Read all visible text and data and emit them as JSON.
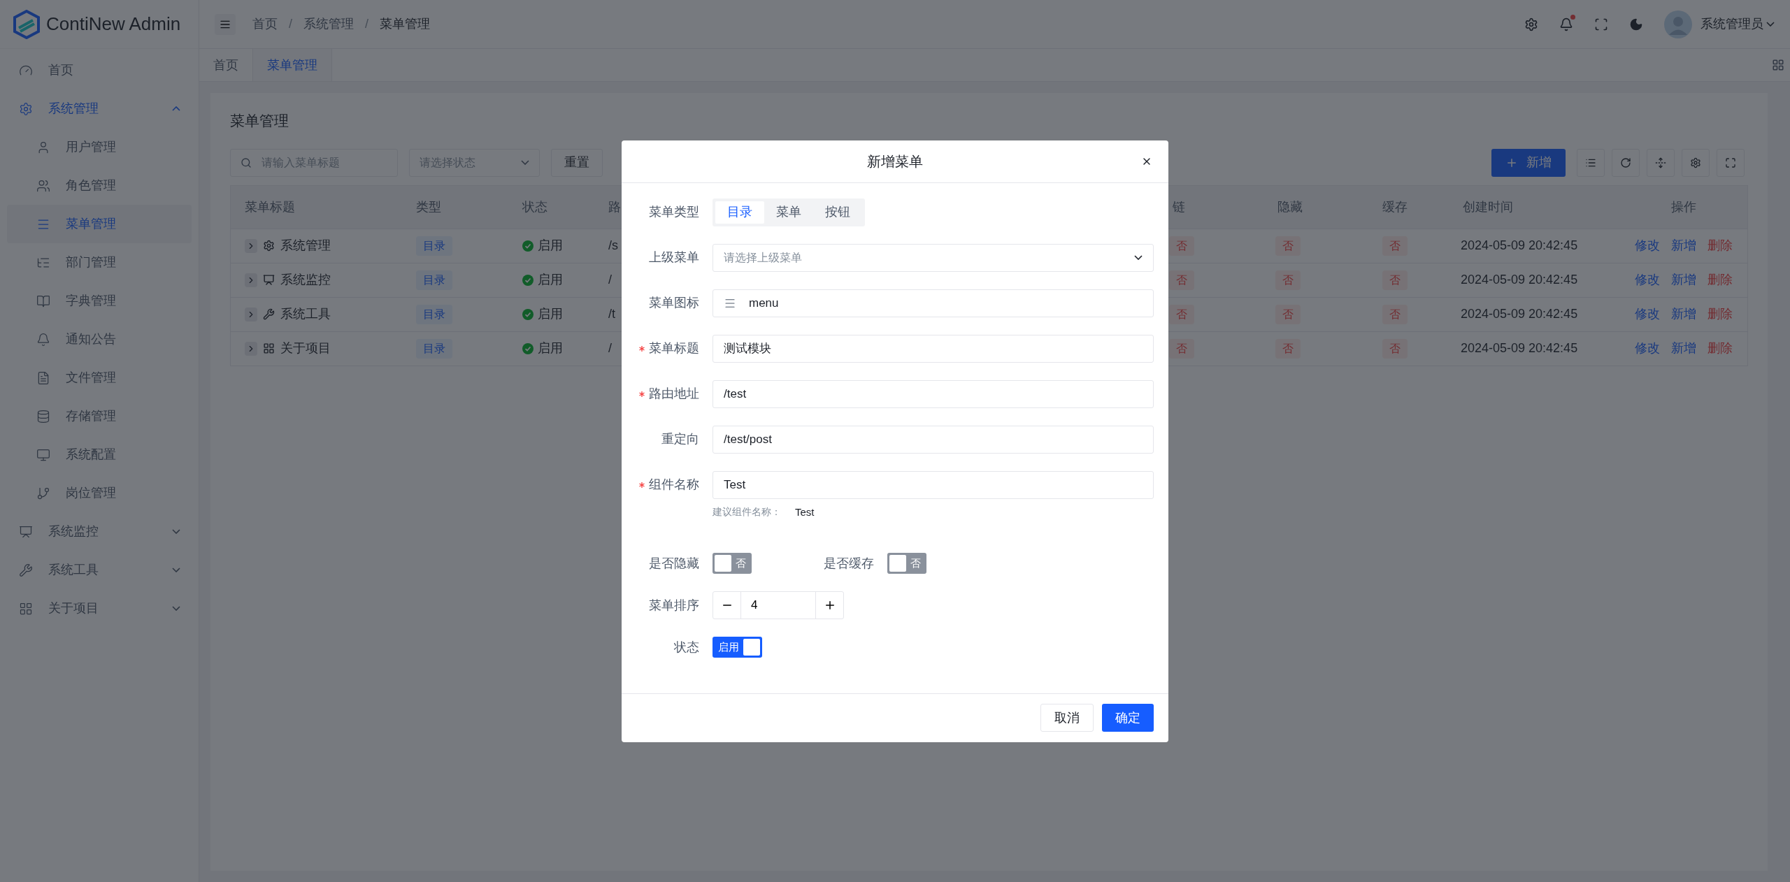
{
  "header": {
    "logo_text": "ContiNew Admin",
    "breadcrumb": [
      "首页",
      "系统管理",
      "菜单管理"
    ],
    "separators": [
      "/",
      "/"
    ],
    "has_unread": true,
    "user_name": "系统管理员"
  },
  "sidebar": {
    "items": [
      {
        "label": "首页",
        "selected": false
      },
      {
        "label": "系统管理",
        "selected": true,
        "expanded": true,
        "children": [
          {
            "label": "用户管理",
            "selected": false
          },
          {
            "label": "角色管理",
            "selected": false
          },
          {
            "label": "菜单管理",
            "selected": true
          },
          {
            "label": "部门管理",
            "selected": false
          },
          {
            "label": "字典管理",
            "selected": false
          },
          {
            "label": "通知公告",
            "selected": false
          },
          {
            "label": "文件管理",
            "selected": false
          },
          {
            "label": "存储管理",
            "selected": false
          },
          {
            "label": "系统配置",
            "selected": false
          },
          {
            "label": "岗位管理",
            "selected": false
          }
        ]
      },
      {
        "label": "系统监控",
        "selected": false,
        "expanded": false
      },
      {
        "label": "系统工具",
        "selected": false,
        "expanded": false
      },
      {
        "label": "关于项目",
        "selected": false,
        "expanded": false
      }
    ]
  },
  "tabs": [
    {
      "label": "首页",
      "selected": false
    },
    {
      "label": "菜单管理",
      "selected": true
    }
  ],
  "page_title": "菜单管理",
  "toolbar": {
    "search_placeholder": "请输入菜单标题",
    "status_placeholder": "请选择状态",
    "reset_label": "重置",
    "add_label": "新增"
  },
  "table": {
    "columns": [
      "菜单标题",
      "类型",
      "状态",
      "路",
      "链",
      "隐藏",
      "缓存",
      "创建时间",
      "操作"
    ],
    "rows": [
      {
        "title": "系统管理",
        "type": "目录",
        "status": "启用",
        "path": "/s",
        "external": "否",
        "hidden": "否",
        "cache": "否",
        "created": "2024-05-09 20:42:45",
        "actions": [
          {
            "label": "修改",
            "kind": "link"
          },
          {
            "label": "新增",
            "kind": "link"
          },
          {
            "label": "删除",
            "kind": "danger"
          }
        ]
      },
      {
        "title": "系统监控",
        "type": "目录",
        "status": "启用",
        "path": "/",
        "external": "否",
        "hidden": "否",
        "cache": "否",
        "created": "2024-05-09 20:42:45",
        "actions": [
          {
            "label": "修改",
            "kind": "link"
          },
          {
            "label": "新增",
            "kind": "link"
          },
          {
            "label": "删除",
            "kind": "danger"
          }
        ]
      },
      {
        "title": "系统工具",
        "type": "目录",
        "status": "启用",
        "path": "/t",
        "external": "否",
        "hidden": "否",
        "cache": "否",
        "created": "2024-05-09 20:42:45",
        "actions": [
          {
            "label": "修改",
            "kind": "link"
          },
          {
            "label": "新增",
            "kind": "link"
          },
          {
            "label": "删除",
            "kind": "danger"
          }
        ]
      },
      {
        "title": "关于项目",
        "type": "目录",
        "status": "启用",
        "path": "/",
        "external": "否",
        "hidden": "否",
        "cache": "否",
        "created": "2024-05-09 20:42:45",
        "actions": [
          {
            "label": "修改",
            "kind": "link"
          },
          {
            "label": "新增",
            "kind": "link"
          },
          {
            "label": "删除",
            "kind": "danger"
          }
        ]
      }
    ]
  },
  "modal": {
    "title": "新增菜单",
    "fields": [
      {
        "kind": "segmented",
        "label": "菜单类型",
        "required": false,
        "options": [
          {
            "label": "目录",
            "selected": true
          },
          {
            "label": "菜单",
            "selected": false
          },
          {
            "label": "按钮",
            "selected": false
          }
        ]
      },
      {
        "kind": "select",
        "label": "上级菜单",
        "required": false,
        "placeholder": "请选择上级菜单"
      },
      {
        "kind": "icon-input",
        "label": "菜单图标",
        "required": false,
        "value": "menu"
      },
      {
        "kind": "text",
        "label": "菜单标题",
        "required": true,
        "value": "测试模块"
      },
      {
        "kind": "text",
        "label": "路由地址",
        "required": true,
        "value": "/test"
      },
      {
        "kind": "text",
        "label": "重定向",
        "required": false,
        "value": "/test/post"
      },
      {
        "kind": "text",
        "label": "组件名称",
        "required": true,
        "value": "Test",
        "hint_label": "建议组件名称：",
        "hint_value": "Test"
      },
      {
        "kind": "switch-pair",
        "items": [
          {
            "label": "是否隐藏",
            "on": false,
            "text": "否"
          },
          {
            "label": "是否缓存",
            "on": false,
            "text": "否"
          }
        ]
      },
      {
        "kind": "number",
        "label": "菜单排序",
        "required": false,
        "value": "4"
      },
      {
        "kind": "switch",
        "label": "状态",
        "required": false,
        "on": true,
        "text": "启用"
      }
    ],
    "buttons": [
      {
        "label": "取消",
        "kind": "secondary"
      },
      {
        "label": "确定",
        "kind": "primary"
      }
    ]
  }
}
